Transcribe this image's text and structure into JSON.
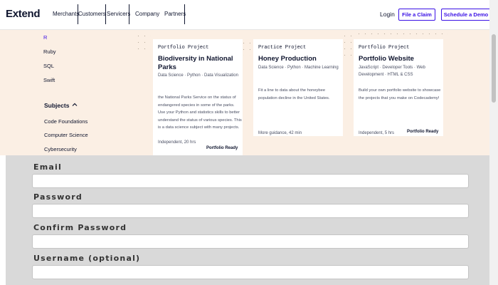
{
  "header": {
    "logo": "Extend",
    "nav": [
      "Merchants",
      "Customers",
      "Servicers",
      "Company",
      "Partners"
    ],
    "login": "Login",
    "file_claim": "File a Claim",
    "schedule_demo": "Schedule a Demo"
  },
  "menu": {
    "languages": [
      "R",
      "Ruby",
      "SQL",
      "Swift"
    ],
    "subjects_heading": "Subjects",
    "subjects": [
      "Code Foundations",
      "Computer Science",
      "Cybersecurity"
    ]
  },
  "cards": [
    {
      "type": "Portfolio Project",
      "title": "Biodiversity in National Parks",
      "tags": "Data Science · Python · Data Visualization",
      "description": "the National Parks Service on the status of endangered species in some of the parks. Use your Python and statistics skills to better understand the status of various species. This is a data science subject with many projects.",
      "meta": "Independent, 20 hrs",
      "badge": "Portfolio Ready"
    },
    {
      "type": "Practice Project",
      "title": "Honey Production",
      "tags": "Data Science · Python · Machine Learning",
      "description": "Fit a line to data about the honeybee population decline in the United States.",
      "meta": "More guidance, 42 min",
      "badge": ""
    },
    {
      "type": "Portfolio Project",
      "title": "Portfolio Website",
      "tags": "JavaScript · Developer Tools · Web Development · HTML & CSS",
      "description": "Build your own portfolio website to showcase the projects that you make on Codecademy!",
      "meta": "Independent, 5 hrs",
      "badge": "Portfolio Ready"
    }
  ],
  "form": {
    "email_label": "Email",
    "password_label": "Password",
    "confirm_label": "Confirm Password",
    "username_label": "Username (optional)"
  }
}
